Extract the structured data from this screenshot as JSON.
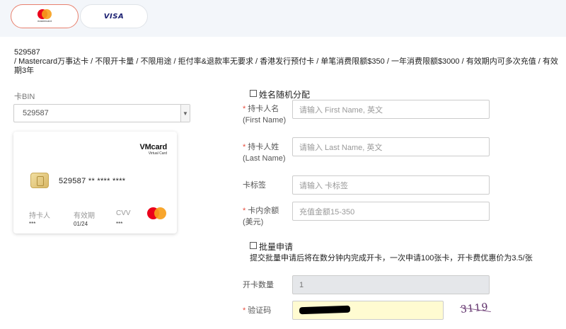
{
  "payment_tabs": [
    {
      "name": "mastercard",
      "logo_text": "mastercard"
    },
    {
      "name": "visa",
      "logo_text": "VISA"
    }
  ],
  "description": {
    "bin_line": "529587",
    "detail": "/ Mastercard万事达卡 / 不限开卡量 / 不限用途 / 拒付率&退款率无要求 / 香港发行预付卡 / 单笔消费限额$350 / 一年消费限额$3000 / 有效期内可多次充值 / 有效期3年"
  },
  "bin": {
    "label": "卡BIN",
    "selected": "529587"
  },
  "card_preview": {
    "brand": "VMcard",
    "brand_sub": "Virtual Card",
    "number": "529587 ** **** ****",
    "holder_label": "持卡人",
    "holder_value": "***",
    "expiry_label": "有效期",
    "expiry_value": "01/24",
    "cvv_label": "CVV",
    "cvv_value": "***"
  },
  "form": {
    "random_name_label": "姓名随机分配",
    "first_name": {
      "label": "持卡人名",
      "sub": "(First Name)",
      "placeholder": "请输入 First Name, 英文"
    },
    "last_name": {
      "label": "持卡人姓",
      "sub": "(Last Name)",
      "placeholder": "请输入 Last Name, 英文"
    },
    "card_tag": {
      "label": "卡标签",
      "placeholder": "请输入 卡标签"
    },
    "balance": {
      "label": "卡内余额",
      "sub": "(美元)",
      "placeholder": "充值金额15-350"
    },
    "batch_label": "批量申请",
    "batch_desc": "提交批量申请后将在数分钟内完成开卡，一次申请100张卡，开卡费优惠价为3.5/张",
    "quantity": {
      "label": "开卡数量",
      "value": "1"
    },
    "captcha": {
      "label": "验证码",
      "image_text": "3119"
    }
  },
  "colors": {
    "accent_border": "#e8806e",
    "required_star": "#e74c3c",
    "captcha_bg": "#fffbd1",
    "topbar_bg": "#f3f6fa"
  }
}
